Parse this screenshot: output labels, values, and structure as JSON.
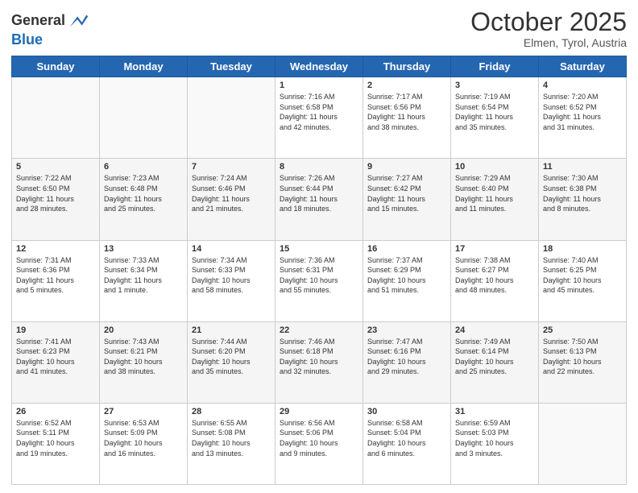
{
  "header": {
    "logo_line1": "General",
    "logo_line2": "Blue",
    "month": "October 2025",
    "location": "Elmen, Tyrol, Austria"
  },
  "weekdays": [
    "Sunday",
    "Monday",
    "Tuesday",
    "Wednesday",
    "Thursday",
    "Friday",
    "Saturday"
  ],
  "weeks": [
    [
      {
        "day": "",
        "info": ""
      },
      {
        "day": "",
        "info": ""
      },
      {
        "day": "",
        "info": ""
      },
      {
        "day": "1",
        "info": "Sunrise: 7:16 AM\nSunset: 6:58 PM\nDaylight: 11 hours\nand 42 minutes."
      },
      {
        "day": "2",
        "info": "Sunrise: 7:17 AM\nSunset: 6:56 PM\nDaylight: 11 hours\nand 38 minutes."
      },
      {
        "day": "3",
        "info": "Sunrise: 7:19 AM\nSunset: 6:54 PM\nDaylight: 11 hours\nand 35 minutes."
      },
      {
        "day": "4",
        "info": "Sunrise: 7:20 AM\nSunset: 6:52 PM\nDaylight: 11 hours\nand 31 minutes."
      }
    ],
    [
      {
        "day": "5",
        "info": "Sunrise: 7:22 AM\nSunset: 6:50 PM\nDaylight: 11 hours\nand 28 minutes."
      },
      {
        "day": "6",
        "info": "Sunrise: 7:23 AM\nSunset: 6:48 PM\nDaylight: 11 hours\nand 25 minutes."
      },
      {
        "day": "7",
        "info": "Sunrise: 7:24 AM\nSunset: 6:46 PM\nDaylight: 11 hours\nand 21 minutes."
      },
      {
        "day": "8",
        "info": "Sunrise: 7:26 AM\nSunset: 6:44 PM\nDaylight: 11 hours\nand 18 minutes."
      },
      {
        "day": "9",
        "info": "Sunrise: 7:27 AM\nSunset: 6:42 PM\nDaylight: 11 hours\nand 15 minutes."
      },
      {
        "day": "10",
        "info": "Sunrise: 7:29 AM\nSunset: 6:40 PM\nDaylight: 11 hours\nand 11 minutes."
      },
      {
        "day": "11",
        "info": "Sunrise: 7:30 AM\nSunset: 6:38 PM\nDaylight: 11 hours\nand 8 minutes."
      }
    ],
    [
      {
        "day": "12",
        "info": "Sunrise: 7:31 AM\nSunset: 6:36 PM\nDaylight: 11 hours\nand 5 minutes."
      },
      {
        "day": "13",
        "info": "Sunrise: 7:33 AM\nSunset: 6:34 PM\nDaylight: 11 hours\nand 1 minute."
      },
      {
        "day": "14",
        "info": "Sunrise: 7:34 AM\nSunset: 6:33 PM\nDaylight: 10 hours\nand 58 minutes."
      },
      {
        "day": "15",
        "info": "Sunrise: 7:36 AM\nSunset: 6:31 PM\nDaylight: 10 hours\nand 55 minutes."
      },
      {
        "day": "16",
        "info": "Sunrise: 7:37 AM\nSunset: 6:29 PM\nDaylight: 10 hours\nand 51 minutes."
      },
      {
        "day": "17",
        "info": "Sunrise: 7:38 AM\nSunset: 6:27 PM\nDaylight: 10 hours\nand 48 minutes."
      },
      {
        "day": "18",
        "info": "Sunrise: 7:40 AM\nSunset: 6:25 PM\nDaylight: 10 hours\nand 45 minutes."
      }
    ],
    [
      {
        "day": "19",
        "info": "Sunrise: 7:41 AM\nSunset: 6:23 PM\nDaylight: 10 hours\nand 41 minutes."
      },
      {
        "day": "20",
        "info": "Sunrise: 7:43 AM\nSunset: 6:21 PM\nDaylight: 10 hours\nand 38 minutes."
      },
      {
        "day": "21",
        "info": "Sunrise: 7:44 AM\nSunset: 6:20 PM\nDaylight: 10 hours\nand 35 minutes."
      },
      {
        "day": "22",
        "info": "Sunrise: 7:46 AM\nSunset: 6:18 PM\nDaylight: 10 hours\nand 32 minutes."
      },
      {
        "day": "23",
        "info": "Sunrise: 7:47 AM\nSunset: 6:16 PM\nDaylight: 10 hours\nand 29 minutes."
      },
      {
        "day": "24",
        "info": "Sunrise: 7:49 AM\nSunset: 6:14 PM\nDaylight: 10 hours\nand 25 minutes."
      },
      {
        "day": "25",
        "info": "Sunrise: 7:50 AM\nSunset: 6:13 PM\nDaylight: 10 hours\nand 22 minutes."
      }
    ],
    [
      {
        "day": "26",
        "info": "Sunrise: 6:52 AM\nSunset: 5:11 PM\nDaylight: 10 hours\nand 19 minutes."
      },
      {
        "day": "27",
        "info": "Sunrise: 6:53 AM\nSunset: 5:09 PM\nDaylight: 10 hours\nand 16 minutes."
      },
      {
        "day": "28",
        "info": "Sunrise: 6:55 AM\nSunset: 5:08 PM\nDaylight: 10 hours\nand 13 minutes."
      },
      {
        "day": "29",
        "info": "Sunrise: 6:56 AM\nSunset: 5:06 PM\nDaylight: 10 hours\nand 9 minutes."
      },
      {
        "day": "30",
        "info": "Sunrise: 6:58 AM\nSunset: 5:04 PM\nDaylight: 10 hours\nand 6 minutes."
      },
      {
        "day": "31",
        "info": "Sunrise: 6:59 AM\nSunset: 5:03 PM\nDaylight: 10 hours\nand 3 minutes."
      },
      {
        "day": "",
        "info": ""
      }
    ]
  ]
}
